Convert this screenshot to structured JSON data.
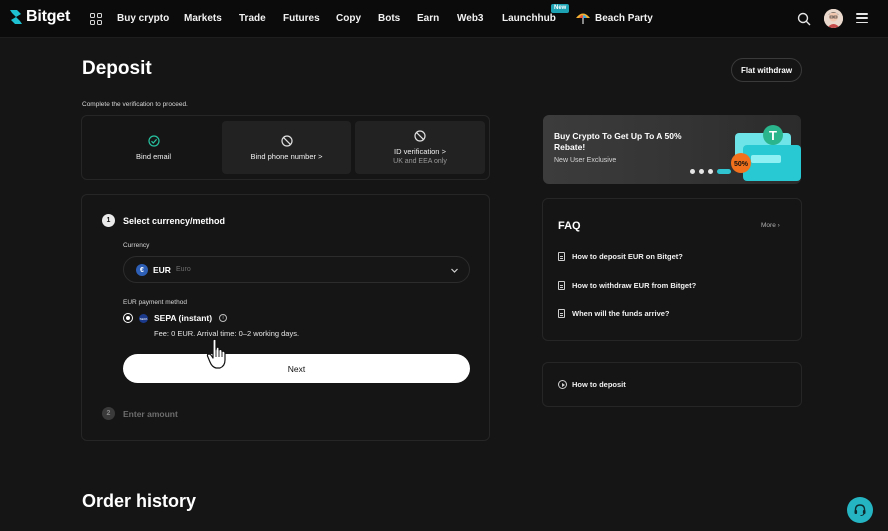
{
  "nav": {
    "brand": "Bitget",
    "items": [
      "Buy crypto",
      "Markets",
      "Trade",
      "Futures",
      "Copy",
      "Bots",
      "Earn",
      "Web3",
      "Launchhub"
    ],
    "new_badge": "New",
    "promo_item": "Beach Party",
    "accent_color": "#1da2b4"
  },
  "page": {
    "title": "Deposit",
    "flat_withdraw": "Flat withdraw",
    "verify_note": "Complete the verification to proceed."
  },
  "verification": {
    "steps": [
      {
        "label": "Bind email",
        "sub": "",
        "status": "done",
        "icon": "check-circle-icon"
      },
      {
        "label": "Bind phone number >",
        "sub": "",
        "status": "pending",
        "icon": "block-icon"
      },
      {
        "label": "ID verification >",
        "sub": "UK and EEA only",
        "status": "pending",
        "icon": "block-icon"
      }
    ]
  },
  "form": {
    "step1_number": "1",
    "step1_title": "Select currency/method",
    "currency_label": "Currency",
    "currency_code": "EUR",
    "currency_name": "Euro",
    "currency_symbol": "€",
    "method_label": "EUR payment method",
    "method_name": "SEPA (instant)",
    "method_icon_text": "SEPA",
    "method_info": "i",
    "fee_text": "Fee: 0 EUR. Arrival time: 0–2 working days.",
    "next_label": "Next",
    "step2_number": "2",
    "step2_title": "Enter amount"
  },
  "promo": {
    "title": "Buy Crypto To Get Up To A 50% Rebate!",
    "subtitle": "New User Exclusive",
    "badge": "50%",
    "slides": 4,
    "active_slide": 4
  },
  "faq": {
    "title": "FAQ",
    "more": "More",
    "items": [
      "How to deposit EUR on Bitget?",
      "How to withdraw EUR from Bitget?",
      "When will the funds arrive?"
    ]
  },
  "howto": {
    "label": "How to deposit"
  },
  "order_history": {
    "title": "Order history"
  }
}
